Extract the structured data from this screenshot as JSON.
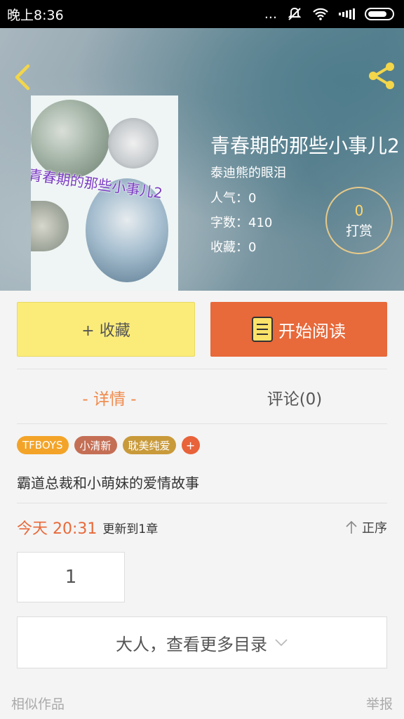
{
  "status_bar": {
    "time": "晚上8:36",
    "dots": "..."
  },
  "header": {
    "book_title": "青春期的那些小事儿2",
    "author": "泰迪熊的眼泪",
    "popularity": "人气：0",
    "word_count": "字数：410",
    "favorites": "收藏：0",
    "tip_count": "0",
    "tip_label": "打赏",
    "cover_text": "青春期的那些小事儿2"
  },
  "actions": {
    "favorite_label": "+ 收藏",
    "read_label": "开始阅读"
  },
  "tabs": {
    "detail": "- 详情 -",
    "comments": "评论(0)"
  },
  "tags": [
    "TFBOYS",
    "小清新",
    "耽美纯爱"
  ],
  "tag_add": "+",
  "description": "霸道总裁和小萌妹的爱情故事",
  "update": {
    "time": "今天 20:31",
    "text": "更新到1章",
    "sort_label": "正序"
  },
  "chapters": [
    "1"
  ],
  "more_catalog": "大人，查看更多目录",
  "footer": {
    "similar": "相似作品",
    "report": "举报"
  },
  "colors": {
    "accent": "#e8693a",
    "favorite_bg": "#fbec7a",
    "tab_active": "#f08a4b"
  },
  "icons": {
    "back": "chevron-left-icon",
    "share": "share-icon",
    "book": "book-icon",
    "sort": "arrow-up-icon",
    "expand": "chevron-down-icon"
  }
}
